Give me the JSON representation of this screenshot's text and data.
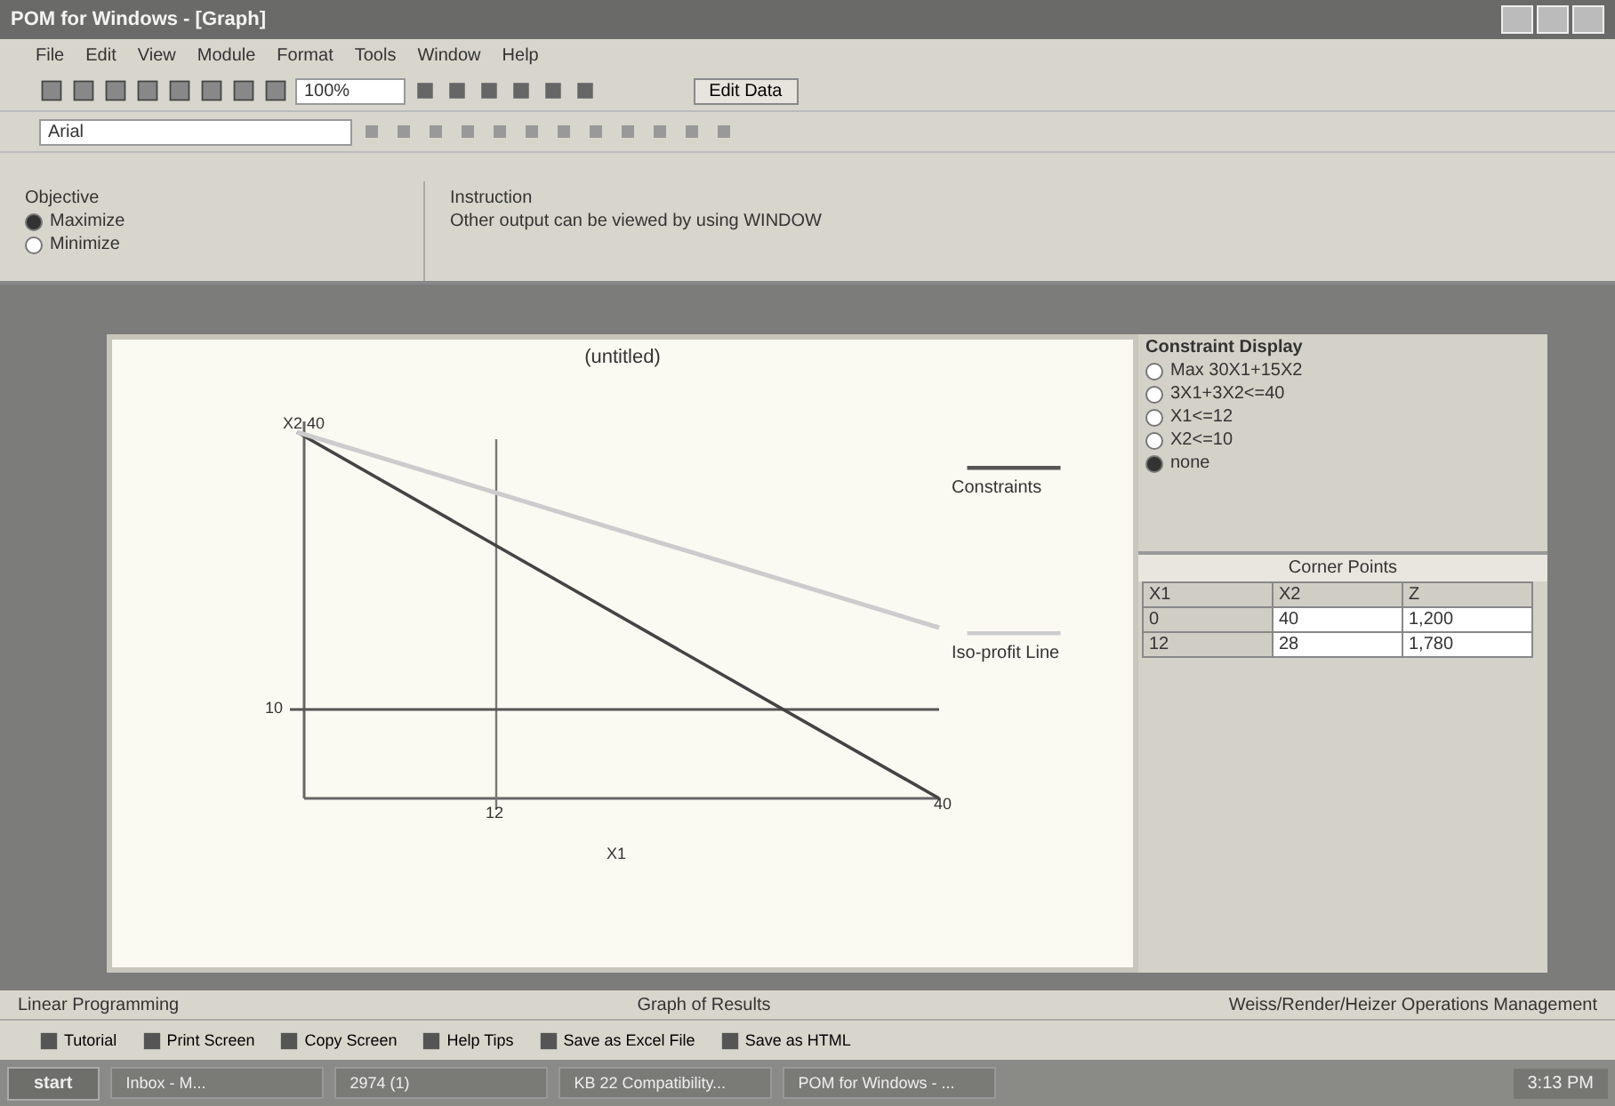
{
  "window": {
    "title": "POM for Windows - [Graph]"
  },
  "menu": [
    "File",
    "Edit",
    "View",
    "Module",
    "Format",
    "Tools",
    "Window",
    "Help"
  ],
  "toolbar": {
    "zoom": "100%",
    "solve_button": "Edit Data"
  },
  "format_bar": {
    "font": "Arial"
  },
  "objective": {
    "title": "Objective",
    "options": [
      {
        "label": "Maximize",
        "selected": true
      },
      {
        "label": "Minimize",
        "selected": false
      }
    ]
  },
  "instruction": {
    "title": "Instruction",
    "text": "Other output can be viewed by using WINDOW"
  },
  "graph": {
    "title": "(untitled)",
    "ylabel": "X2",
    "xlabel": "X1",
    "y_ticks": [
      "40",
      "10"
    ],
    "x_ticks": [
      "12",
      "40"
    ],
    "legend": [
      "Constraints",
      "Iso-profit Line"
    ]
  },
  "constraint_display": {
    "title": "Constraint Display",
    "options": [
      {
        "label": "Max 30X1+15X2",
        "selected": false
      },
      {
        "label": "3X1+3X2<=40",
        "selected": false
      },
      {
        "label": "X1<=12",
        "selected": false
      },
      {
        "label": "X2<=10",
        "selected": false
      },
      {
        "label": "none",
        "selected": true
      }
    ]
  },
  "corner_points": {
    "title": "Corner Points",
    "columns": [
      "X1",
      "X2",
      "Z"
    ],
    "rows": [
      [
        "0",
        "40",
        "1,200"
      ],
      [
        "12",
        "28",
        "1,780"
      ]
    ]
  },
  "status_bar": [
    "Linear Programming",
    "Graph of Results",
    "Weiss/Render/Heizer Operations Management"
  ],
  "bottom_toolbar": [
    "Tutorial",
    "Print Screen",
    "Copy Screen",
    "Help Tips",
    "Save as Excel File",
    "Save as HTML"
  ],
  "taskbar": {
    "start": "start",
    "tasks": [
      "Inbox - M...",
      "2974 (1)",
      "KB 22 Compatibility...",
      "POM for Windows - ..."
    ],
    "clock": "3:13 PM"
  }
}
